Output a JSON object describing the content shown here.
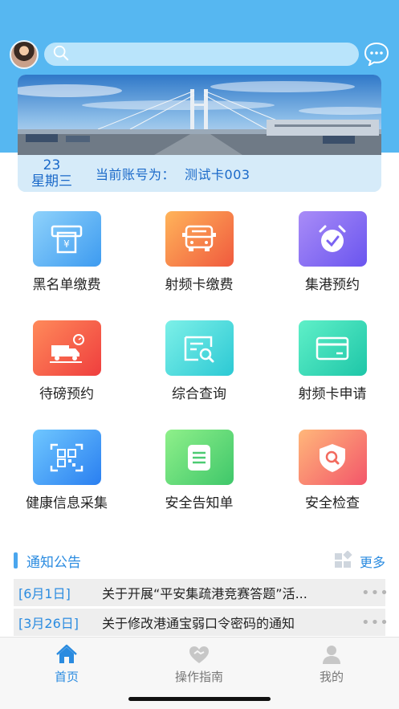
{
  "header": {
    "avatar_icon": "user-avatar",
    "search": {
      "placeholder": "",
      "icon": "search-icon"
    },
    "message_icon": "chat-bubble-icon",
    "accent_color": "#56b7f1"
  },
  "banner": {
    "date_day": "23",
    "weekday": "星期三",
    "account_label": "当前账号为：",
    "account_value": "测试卡003"
  },
  "grid": [
    {
      "label": "黑名单缴费",
      "icon": "payment-terminal-icon",
      "colors": [
        "#8fd2fb",
        "#3d9bf0"
      ]
    },
    {
      "label": "射频卡缴费",
      "icon": "truck-front-icon",
      "colors": [
        "#ffb45a",
        "#f05a3e"
      ]
    },
    {
      "label": "集港预约",
      "icon": "alarm-clock-icon",
      "colors": [
        "#a98cf7",
        "#6a55ef"
      ]
    },
    {
      "label": "待磅预约",
      "icon": "truck-scale-icon",
      "colors": [
        "#ff8a5a",
        "#ef3e3e"
      ]
    },
    {
      "label": "综合查询",
      "icon": "document-search-icon",
      "colors": [
        "#7df0e8",
        "#2cc9d4"
      ]
    },
    {
      "label": "射频卡申请",
      "icon": "card-icon",
      "colors": [
        "#5ff0c8",
        "#1ec6a8"
      ]
    },
    {
      "label": "健康信息采集",
      "icon": "qr-code-icon",
      "colors": [
        "#6fc7ff",
        "#2a7ff0"
      ]
    },
    {
      "label": "安全告知单",
      "icon": "note-icon",
      "colors": [
        "#8ff08a",
        "#3fc76a"
      ]
    },
    {
      "label": "安全检查",
      "icon": "shield-search-icon",
      "colors": [
        "#ffb77a",
        "#f3566a"
      ]
    }
  ],
  "notices": {
    "title": "通知公告",
    "more_label": "更多",
    "more_icon": "grid-more-icon",
    "items": [
      {
        "date": "[6月1日]",
        "text": "关于开展“平安集疏港竞赛答题”活..."
      },
      {
        "date": "[3月26日]",
        "text": "关于修改港通宝弱口令密码的通知"
      }
    ]
  },
  "tabbar": {
    "tabs": [
      {
        "label": "首页",
        "icon": "home-icon",
        "active": true
      },
      {
        "label": "操作指南",
        "icon": "handshake-icon",
        "active": false
      },
      {
        "label": "我的",
        "icon": "user-icon",
        "active": false
      }
    ],
    "active_color": "#2a8be0"
  }
}
